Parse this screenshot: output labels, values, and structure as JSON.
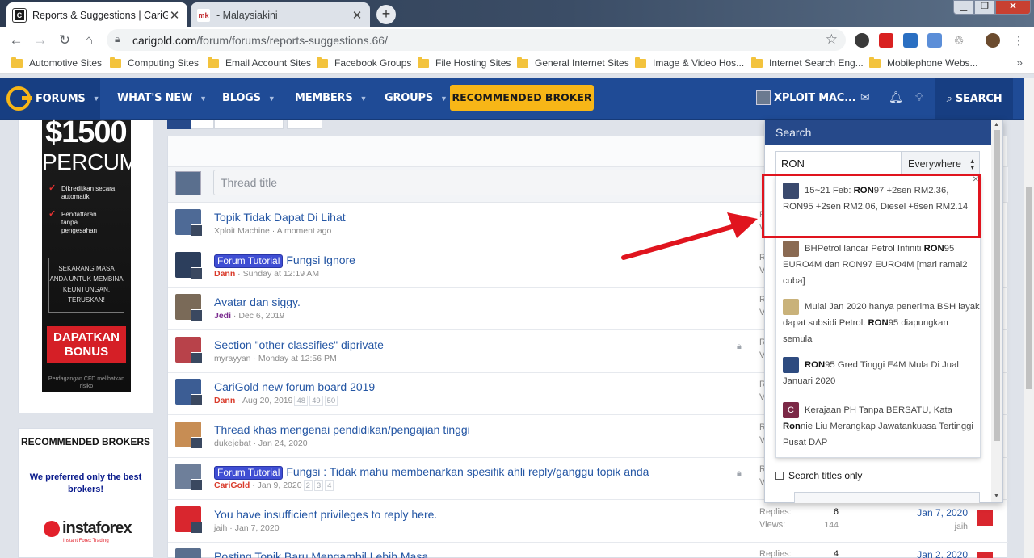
{
  "browser": {
    "tabs": [
      {
        "title": "Reports & Suggestions | CariGold",
        "close": "✕"
      },
      {
        "title": "- Malaysiakini",
        "close": "✕"
      }
    ],
    "favicon_mk": "mk",
    "new_tab": "+",
    "url_domain": "carigold.com",
    "url_path": "/forum/forums/reports-suggestions.66/",
    "window_controls": {
      "min": "▁",
      "max": "❐",
      "close": "✕"
    },
    "bookmarks": [
      "Automotive Sites",
      "Computing Sites",
      "Email Account Sites",
      "Facebook Groups",
      "File Hosting Sites",
      "General Internet Sites",
      "Image & Video Hos...",
      "Internet Search Eng...",
      "Mobilephone Webs..."
    ],
    "bookmarks_more": "»"
  },
  "nav": {
    "forums": "FORUMS",
    "whats_new": "WHAT'S NEW",
    "blogs": "BLOGS",
    "members": "MEMBERS",
    "groups": "GROUPS",
    "recommended_broker": "RECOMMENDED BROKER",
    "user": "XPLOIT MAC...",
    "search": "SEARCH",
    "caret": "▼"
  },
  "sidebar": {
    "ad": {
      "amount": "$1500",
      "free": "PERCUMA",
      "point1": "Dikreditkan secara automatik",
      "point2": "Pendaftaran tanpa pengesahan",
      "box_text": "SEKARANG MASA ANDA UNTUK MEMBINA KEUNTUNGAN. TERUSKAN!",
      "cta": "DAPATKAN BONUS",
      "disclaimer": "Perdagangan CFD melibatkan risiko"
    },
    "brokers": {
      "heading": "RECOMMENDED BROKERS",
      "preferred": "We preferred only the best brokers!",
      "logo_name": "instaforex",
      "logo_sub": "Instant Forex Trading"
    }
  },
  "threads": {
    "placeholder": "Thread title",
    "rows": [
      {
        "prefix": "",
        "title": "Topik Tidak Dapat Di Lihat",
        "author": "Xploit Machine",
        "date": "A moment ago",
        "pages": [],
        "locked": false,
        "stats": false
      },
      {
        "prefix": "Forum Tutorial",
        "title": "Fungsi Ignore",
        "author": "Dann",
        "date": "Sunday at 12:19 AM",
        "pages": [],
        "locked": false,
        "stats": false
      },
      {
        "prefix": "",
        "title": "Avatar dan siggy.",
        "author": "Jedi",
        "date": "Dec 6, 2019",
        "pages": [],
        "locked": false,
        "stats": false
      },
      {
        "prefix": "",
        "title": "Section \"other classifies\" diprivate",
        "author": "myrayyan",
        "date": "Monday at 12:56 PM",
        "pages": [],
        "locked": true,
        "stats": false
      },
      {
        "prefix": "",
        "title": "CariGold new forum board 2019",
        "author": "Dann",
        "date": "Aug 20, 2019",
        "pages": [
          "48",
          "49",
          "50"
        ],
        "locked": false,
        "stats": false
      },
      {
        "prefix": "",
        "title": "Thread khas mengenai pendidikan/pengajian tinggi",
        "author": "dukejebat",
        "date": "Jan 24, 2020",
        "pages": [],
        "locked": false,
        "stats": false
      },
      {
        "prefix": "Forum Tutorial",
        "title": "Fungsi : Tidak mahu membenarkan spesifik ahli reply/ganggu topik anda",
        "author": "CariGold",
        "date": "Jan 9, 2020",
        "pages": [
          "2",
          "3",
          "4"
        ],
        "locked": true,
        "stats": false
      },
      {
        "prefix": "",
        "title": "You have insufficient privileges to reply here.",
        "author": "jaih",
        "date": "Jan 7, 2020",
        "pages": [],
        "locked": false,
        "stats": true,
        "replies_label": "Replies:",
        "replies": "6",
        "views_label": "Views:",
        "views": "144",
        "latest_date": "Jan 7, 2020",
        "latest_user": "jaih"
      },
      {
        "prefix": "",
        "title": "Posting Topik Baru Mengambil Lebih Masa",
        "author": "",
        "date": "",
        "pages": [],
        "locked": false,
        "stats": true,
        "replies_label": "Replies:",
        "replies": "4",
        "views_label": "",
        "views": "",
        "latest_date": "Jan 2, 2020",
        "latest_user": ""
      }
    ],
    "clipped_stats": [
      {
        "l1": "R",
        "l2": "Vi"
      },
      {
        "l1": "R",
        "l2": "Vi"
      },
      {
        "l1": "R",
        "l2": "Vi"
      },
      {
        "l1": "R",
        "l2": "Vi"
      },
      {
        "l1": "R",
        "l2": "Vi"
      },
      {
        "l1": "R",
        "l2": "Vi"
      },
      {
        "l1": "R",
        "l2": "Vi"
      }
    ],
    "stats_first_clipped": {
      "l1": "R",
      "l2": "Vi"
    }
  },
  "search_menu": {
    "heading": "Search",
    "query": "RON",
    "scope": "Everywhere",
    "scope_arrow": "▲▼",
    "close": "✕",
    "suggestions": [
      {
        "html": "15~21 Feb: <b>RON</b>97 +2sen RM2.36, RON95 +2sen RM2.06, Diesel +6sen RM2.14"
      },
      {
        "html": "BHPetrol lancar Petrol Infiniti <b>RON</b>95 EURO4M dan RON97 EURO4M [mari ramai2 cuba]"
      },
      {
        "html": "Mulai Jan 2020 hanya penerima BSH layak dapat subsidi Petrol. <b>RON</b>95 diapungkan semula"
      },
      {
        "html": "<b>RON</b>95 Gred Tinggi E4M Mula Di Jual Januari 2020"
      },
      {
        "html": "Kerajaan PH Tanpa BERSATU, Kata <b>Ron</b>nie Liu Merangkap Jawatankuasa Tertinggi Pusat DAP"
      }
    ],
    "avatar_letter": "C",
    "search_titles_only": "Search titles only"
  }
}
